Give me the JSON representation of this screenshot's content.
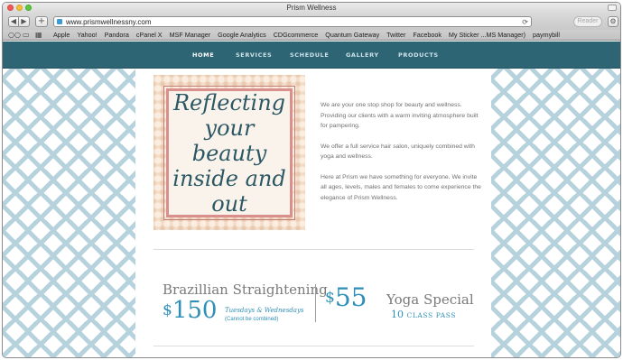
{
  "window": {
    "title": "Prism Wellness"
  },
  "toolbar": {
    "back_label": "◀",
    "forward_label": "▶",
    "new_tab_label": "+",
    "url": "www.prismwellnessny.com",
    "reader_label": "Reader",
    "reload_icon": "⟳",
    "settings_label": "⚙"
  },
  "bookmarks": {
    "items": [
      "Apple",
      "Yahoo!",
      "Pandora",
      "cPanel X",
      "MSF Manager",
      "Google Analytics",
      "CDGcommerce",
      "Quantum Gateway",
      "Twitter",
      "Facebook",
      "My Sticker ...MS Manager)",
      "paymybill"
    ]
  },
  "nav": {
    "items": [
      "HOME",
      "SERVICES",
      "SCHEDULE",
      "GALLERY",
      "PRODUCTS"
    ],
    "active": "HOME"
  },
  "feature": {
    "text": "Reflecting your beauty inside and out"
  },
  "intro": {
    "paragraphs": [
      "We are your one stop shop for beauty and wellness. Providing our clients with a warm inviting atmosphere built for pampering.",
      "We offer a full service hair salon, uniquely combined with yoga and wellness.",
      "Here at Prism we have something for everyone. We invite all ages, levels, males and females to come experience the elegance of Prism Wellness."
    ]
  },
  "promo": {
    "left": {
      "title": "Brazillian Straightening",
      "price_symbol": "$",
      "price": "150",
      "days": "Tuesdays & Wednesdays",
      "note": "(Cannot be combined)"
    },
    "right": {
      "price_symbol": "$",
      "price": "55",
      "title": "Yoga Special",
      "count": "10",
      "count_label": "CLASS PASS"
    }
  },
  "colors": {
    "nav_bg": "#2e6575",
    "accent": "#2f8fb6",
    "chevron": "#9ec3d1",
    "frame": "#d9908c"
  }
}
